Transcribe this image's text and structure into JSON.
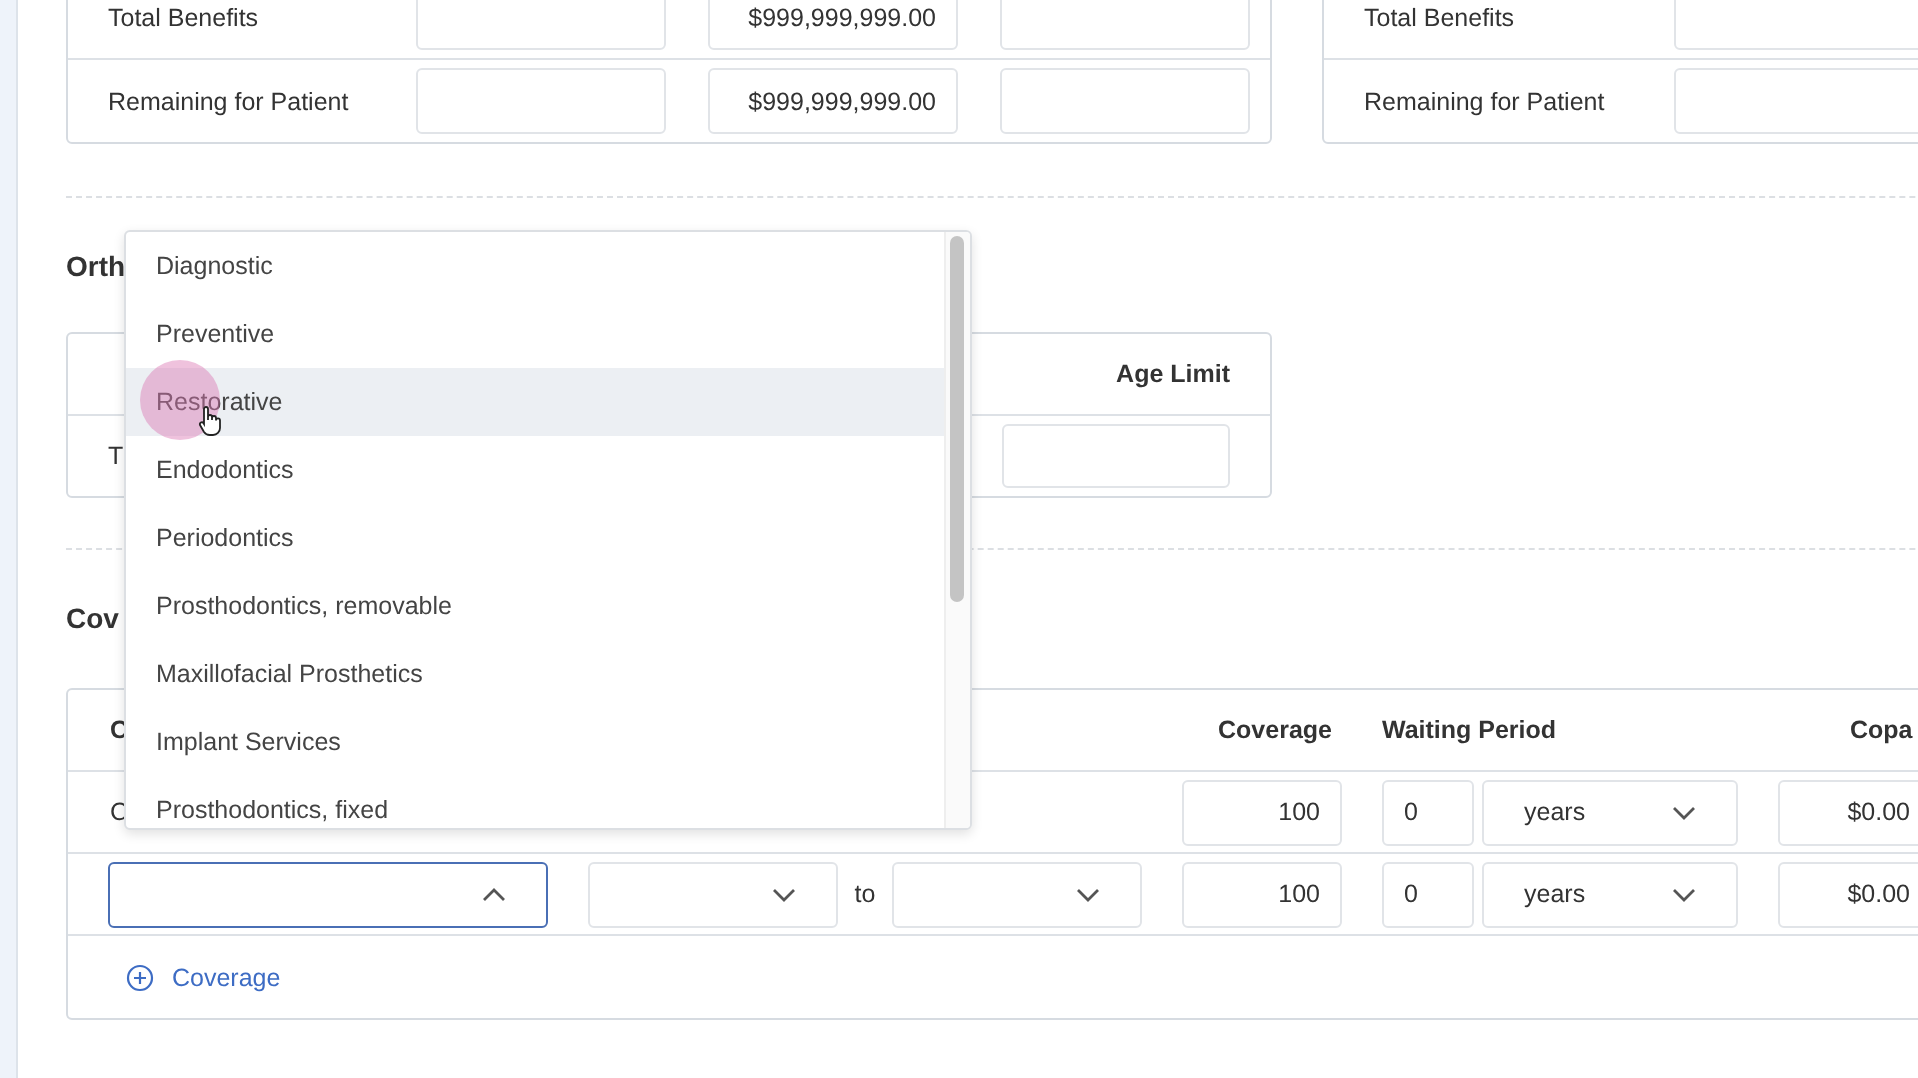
{
  "benefit_cards": [
    {
      "rows": [
        {
          "label": "Total Benefits",
          "fields": [
            {
              "kind": "input"
            },
            {
              "kind": "input",
              "value": "$999,999,999.00"
            },
            {
              "kind": "input"
            }
          ]
        },
        {
          "label": "Remaining for Patient",
          "fields": [
            {
              "kind": "input"
            },
            {
              "kind": "input",
              "value": "$999,999,999.00"
            },
            {
              "kind": "input"
            }
          ]
        }
      ]
    },
    {
      "rows": [
        {
          "label": "Total Benefits",
          "fields": [
            {
              "kind": "input"
            }
          ]
        },
        {
          "label": "Remaining for Patient",
          "fields": [
            {
              "kind": "input"
            }
          ]
        }
      ]
    }
  ],
  "ortho": {
    "heading": "Orth",
    "column": "Age Limit",
    "row_label": "T"
  },
  "coverage": {
    "heading": "Cov",
    "columns": [
      "C",
      "Coverage",
      "Waiting Period",
      "Copa"
    ],
    "rows": [
      {
        "kind": "existing",
        "category": "C",
        "coverage": "100",
        "wait": "0",
        "unit": "years",
        "copay": "$0.00"
      },
      {
        "kind": "new",
        "category_expanded": true,
        "range_word": "to",
        "coverage": "100",
        "wait": "0",
        "unit": "years",
        "copay": "$0.00"
      }
    ],
    "add_button": "Coverage"
  },
  "dropdown": {
    "items": [
      {
        "label": "Diagnostic",
        "highlighted": false
      },
      {
        "label": "Preventive",
        "highlighted": false
      },
      {
        "label": "Restorative",
        "highlighted": true
      },
      {
        "label": "Endodontics",
        "highlighted": false
      },
      {
        "label": "Periodontics",
        "highlighted": false
      },
      {
        "label": "Prosthodontics, removable",
        "highlighted": false
      },
      {
        "label": "Maxillofacial Prosthetics",
        "highlighted": false
      },
      {
        "label": "Implant Services",
        "highlighted": false
      },
      {
        "label": "Prosthodontics, fixed",
        "highlighted": false
      }
    ]
  }
}
